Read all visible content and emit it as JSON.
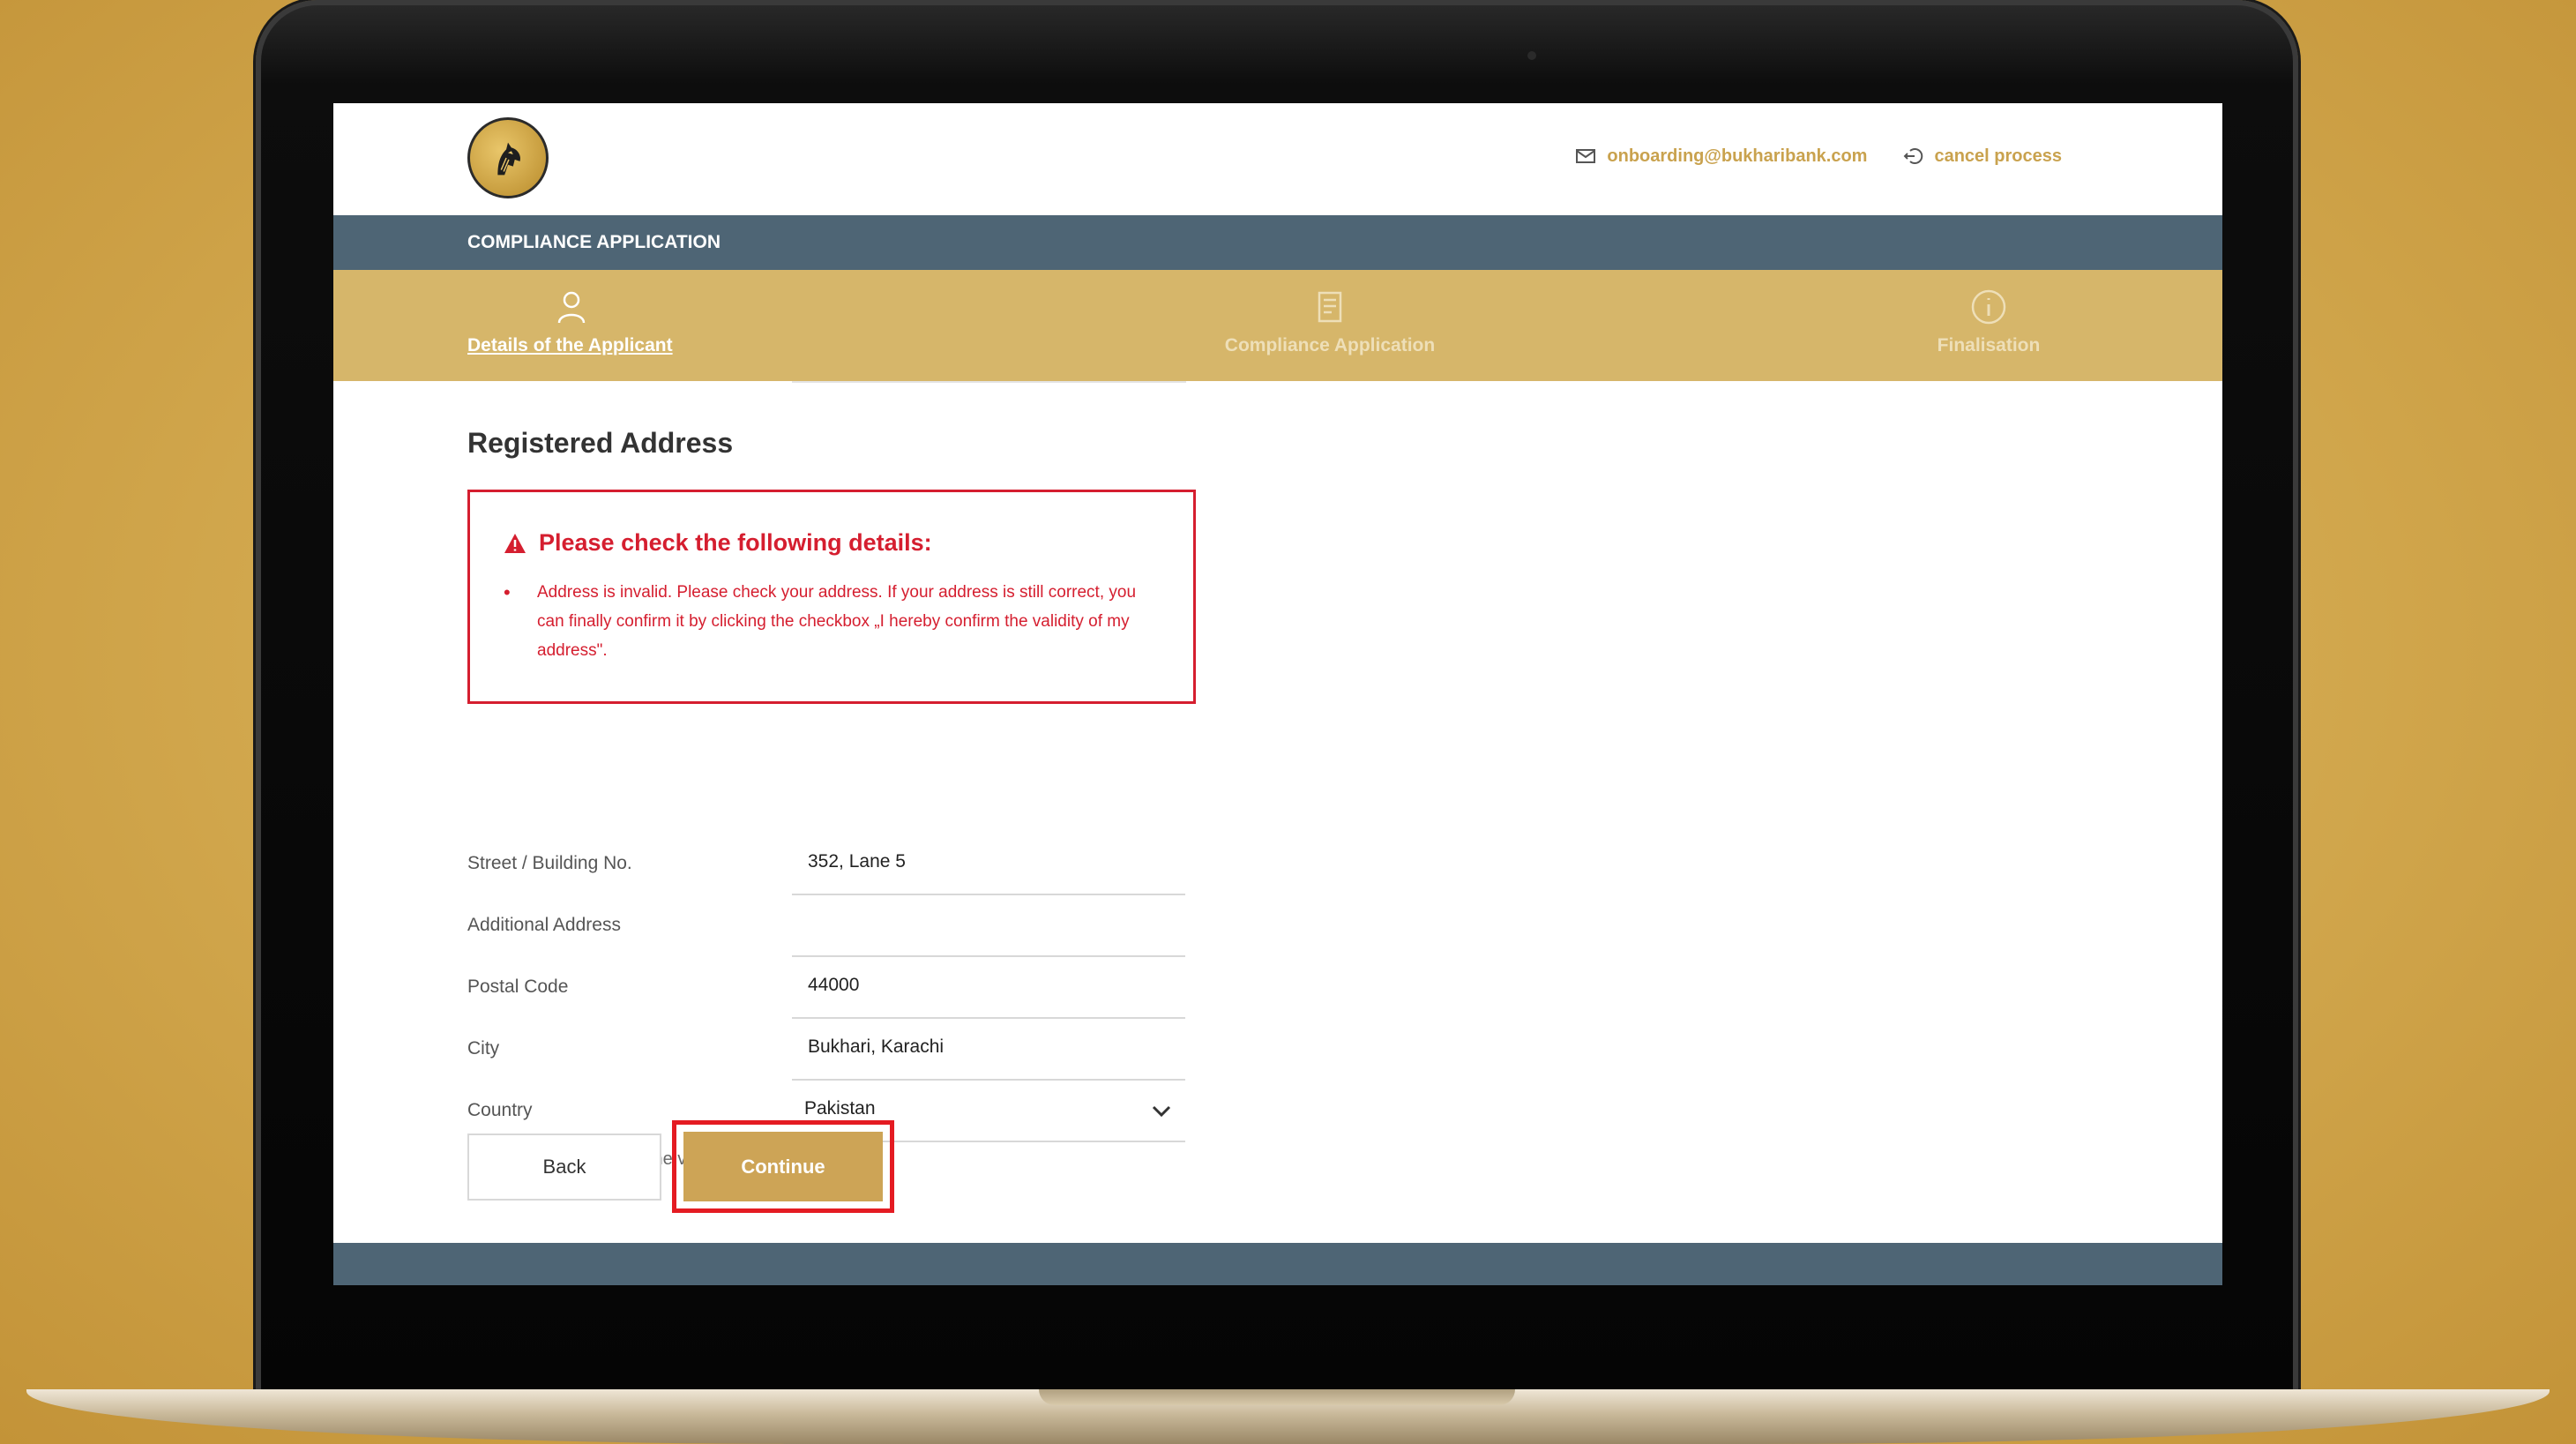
{
  "header": {
    "email": "onboarding@bukharibank.com",
    "cancel": "cancel process"
  },
  "appbar": {
    "title": "COMPLIANCE APPLICATION"
  },
  "steps": [
    {
      "label": "Details of the Applicant",
      "icon": "person-icon",
      "active": true
    },
    {
      "label": "Compliance Application",
      "icon": "document-icon",
      "active": false
    },
    {
      "label": "Finalisation",
      "icon": "info-icon",
      "active": false
    }
  ],
  "form": {
    "heading": "Registered Address",
    "error": {
      "title": "Please check the following details:",
      "message": "Address is invalid. Please check your address. If your address is still correct, you can finally confirm it by clicking the checkbox „I hereby confirm the validity of my address\"."
    },
    "fields": {
      "street": {
        "label": "Street / Building No.",
        "value": "352, Lane 5"
      },
      "additional": {
        "label": "Additional Address",
        "value": ""
      },
      "postal": {
        "label": "Postal Code",
        "value": "44000"
      },
      "city": {
        "label": "City",
        "value": "Bukhari, Karachi"
      },
      "country": {
        "label": "Country",
        "value": "Pakistan"
      }
    },
    "confirm": {
      "label": "I hereby confirm the validity of my address",
      "checked": true
    },
    "back_label": "Back",
    "continue_label": "Continue"
  },
  "colors": {
    "accent_gold": "#d6b66a",
    "bar_slate": "#4e6575",
    "error_red": "#d51e2f",
    "highlight_red": "#e41b22"
  }
}
